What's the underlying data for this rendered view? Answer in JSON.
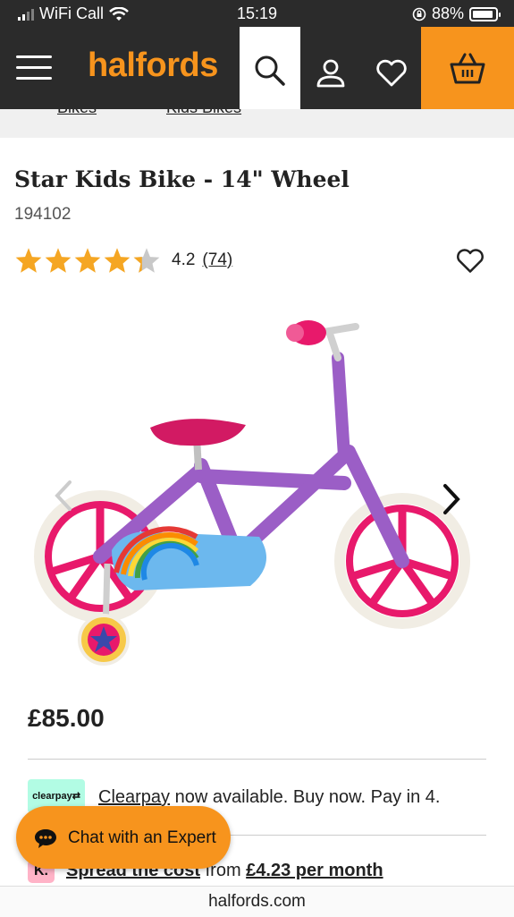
{
  "status_bar": {
    "carrier": "WiFi Call",
    "time": "15:19",
    "battery": "88%"
  },
  "header": {
    "logo": "halfords"
  },
  "breadcrumb": [
    "Bikes",
    "Kids Bikes"
  ],
  "product": {
    "title": "Star Kids Bike - 14\" Wheel",
    "sku": "194102",
    "rating_value": "4.2",
    "rating_count": "(74)",
    "rating_stars": 4.2,
    "price": "£85.00"
  },
  "clearpay": {
    "badge": "clearpay",
    "text_link": "Clearpay",
    "text_rest": " now available. Buy now. Pay in 4."
  },
  "klarna": {
    "badge": "K.",
    "link": "Spread the cost",
    "from": " from ",
    "amount": "£4.23 per month"
  },
  "chat": {
    "label": "Chat with an Expert"
  },
  "url_bar": {
    "domain": "halfords.com"
  },
  "colors": {
    "brand_orange": "#f7941d",
    "header_dark": "#2b2b2b",
    "star_gold": "#f5a623"
  }
}
